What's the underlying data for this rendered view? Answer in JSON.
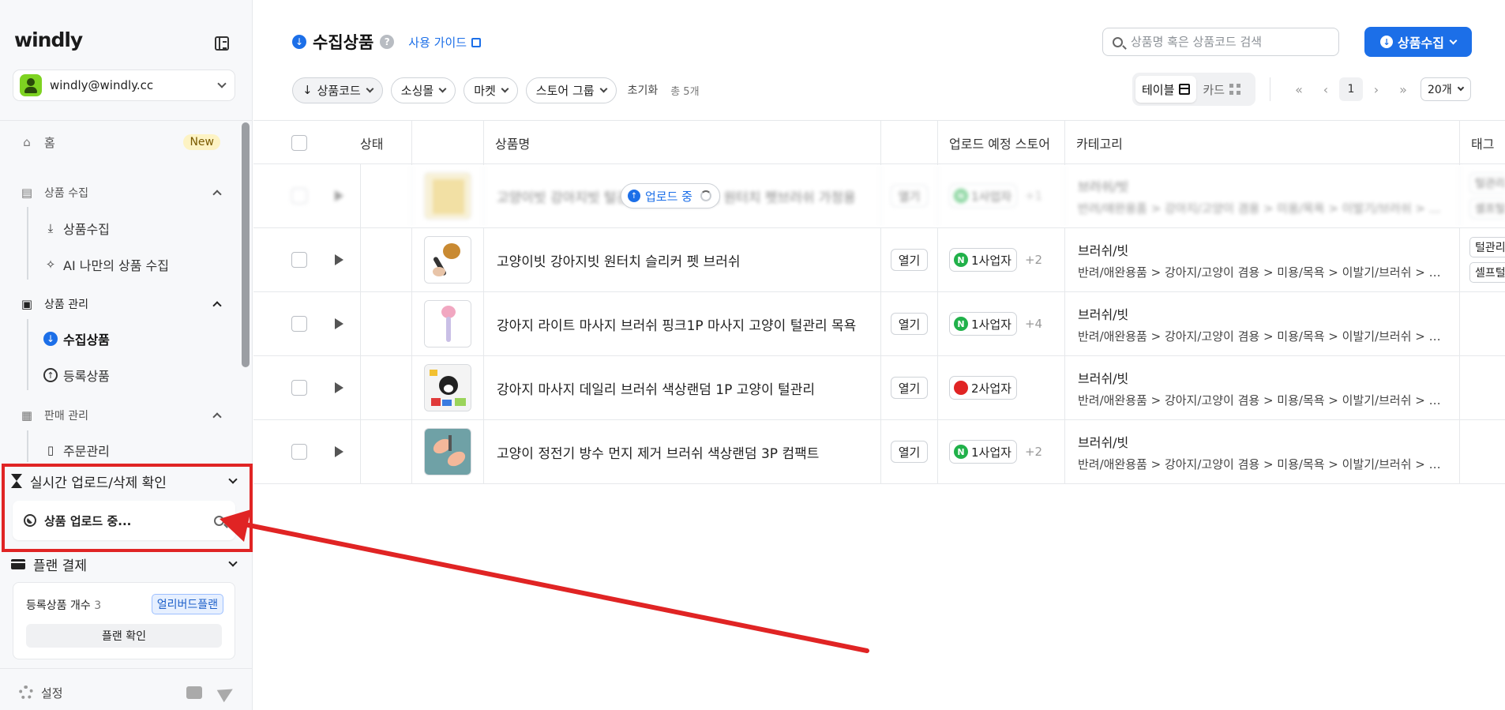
{
  "sidebar": {
    "logo": "windly",
    "account_email": "windly@windly.cc",
    "home": {
      "label": "홈",
      "badge": "New"
    },
    "sections": {
      "collect": {
        "label": "상품 수집",
        "items": [
          "상품수집",
          "AI 나만의 상품 수집"
        ]
      },
      "manage": {
        "label": "상품 관리",
        "items": [
          "수집상품",
          "등록상품"
        ]
      },
      "sales": {
        "label": "판매 관리",
        "items": [
          "주문관리"
        ]
      }
    },
    "realtime": {
      "label": "실시간 업로드/삭제 확인",
      "status": "상품 업로드 중..."
    },
    "plan": {
      "label": "플랜 결제",
      "count_label": "등록상품 개수",
      "count": "3",
      "plan_name": "얼리버드플랜",
      "check_button": "플랜 확인"
    },
    "settings": "설정"
  },
  "header": {
    "title": "수집상품",
    "help": "?",
    "guide_link": "사용 가이드",
    "search_placeholder": "상품명 혹은 상품코드 검색",
    "collect_button": "상품수집"
  },
  "filters": {
    "sort": "상품코드",
    "pills": [
      "소싱몰",
      "마켓",
      "스토어 그룹"
    ],
    "reset": "초기화",
    "total": "총 5개"
  },
  "view_toggle": {
    "table": "테이블",
    "card": "카드"
  },
  "pager": {
    "first": "«",
    "prev": "‹",
    "current": "1",
    "next": "›",
    "last": "»",
    "per_page": "20개"
  },
  "table": {
    "columns": [
      "상태",
      "상품명",
      "업로드 예정 스토어",
      "카테고리",
      "태그"
    ],
    "open_label": "열기",
    "rows": [
      {
        "status": "업로드 중",
        "name": "고양이빗 강아지빗 털관리 슬리커브러쉬 원터치 펫브러쉬 가정용",
        "store": "1사업자",
        "store_extra": "+1",
        "store_logo": "naver",
        "cat_main": "브러쉬/빗",
        "cat_path": "반려/애완용품 > 강아지/고양이 겸용 > 미용/목욕 > 이발기/브러쉬 > 브러쉬/빗",
        "tags": [
          "털관리",
          "셀프털"
        ]
      },
      {
        "status": "",
        "name": "고양이빗 강아지빗 원터치 슬리커 펫 브러쉬",
        "store": "1사업자",
        "store_extra": "+2",
        "store_logo": "naver",
        "cat_main": "브러쉬/빗",
        "cat_path": "반려/애완용품 > 강아지/고양이 겸용 > 미용/목욕 > 이발기/브러쉬 > 브러쉬/빗",
        "tags": [
          "털관리",
          "셀프털"
        ]
      },
      {
        "status": "",
        "name": "강아지 라이트 마사지 브러쉬 핑크1P 마사지 고양이 털관리 목욕",
        "store": "1사업자",
        "store_extra": "+4",
        "store_logo": "naver",
        "cat_main": "브러쉬/빗",
        "cat_path": "반려/애완용품 > 강아지/고양이 겸용 > 미용/목욕 > 이발기/브러쉬 > 브러쉬/빗",
        "tags": []
      },
      {
        "status": "",
        "name": "강아지 마사지 데일리 브러쉬 색상랜덤 1P 고양이 털관리",
        "store": "2사업자",
        "store_extra": "",
        "store_logo": "other",
        "cat_main": "브러쉬/빗",
        "cat_path": "반려/애완용품 > 강아지/고양이 겸용 > 미용/목욕 > 이발기/브러쉬 > 브러쉬/빗",
        "tags": []
      },
      {
        "status": "",
        "name": "고양이 정전기 방수 먼지 제거 브러쉬 색상랜덤 3P 컴팩트",
        "store": "1사업자",
        "store_extra": "+2",
        "store_logo": "naver",
        "cat_main": "브러쉬/빗",
        "cat_path": "반려/애완용품 > 강아지/고양이 겸용 > 미용/목욕 > 이발기/브러쉬 > 브러쉬/빗",
        "tags": []
      }
    ]
  },
  "colors": {
    "accent": "#1c6fe8",
    "annotation": "#e02424",
    "naver": "#21b14a"
  }
}
